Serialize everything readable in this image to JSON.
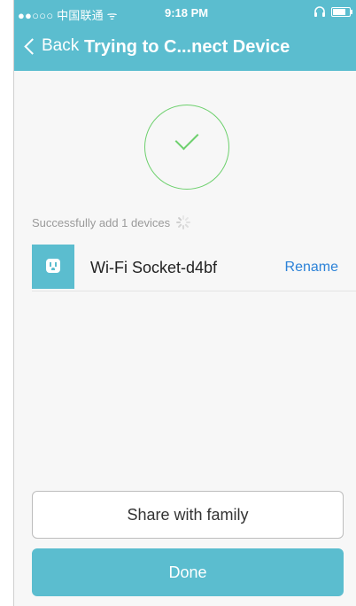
{
  "status_bar": {
    "carrier": "●●○○○ 中国联通 ᯤ",
    "time": "9:18 PM",
    "headphone_icon": "headphones-icon",
    "battery_icon": "battery-icon",
    "battery_level": 0.8
  },
  "nav": {
    "back_label": "Back",
    "title": "Trying to C...nect Device"
  },
  "success": {
    "icon": "check-icon",
    "color": "#6dd06d",
    "message": "Successfully add 1 devices"
  },
  "device": {
    "name": "Wi-Fi Socket-d4bf",
    "icon": "socket-icon",
    "rename_label": "Rename"
  },
  "actions": {
    "share_label": "Share with family",
    "done_label": "Done"
  },
  "colors": {
    "accent": "#5bbdcf",
    "link": "#2c82d8"
  }
}
